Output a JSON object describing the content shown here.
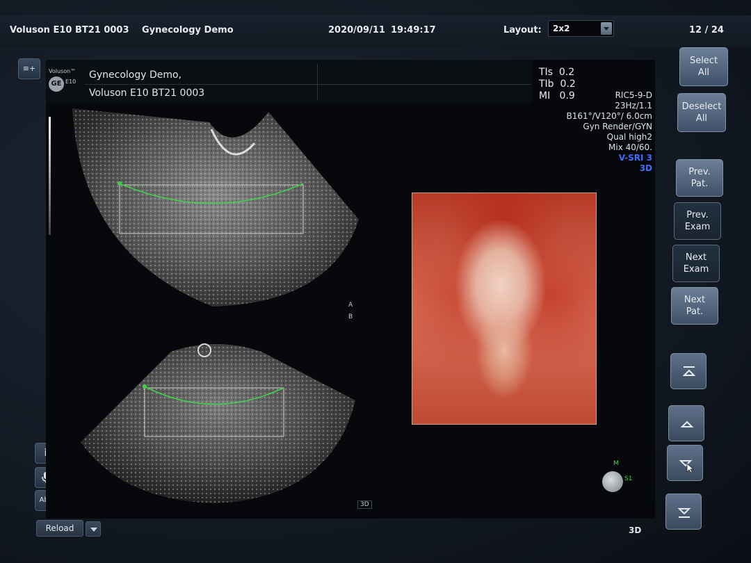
{
  "topbar": {
    "device": "Voluson E10 BT21 0003",
    "demo": "Gynecology Demo",
    "date": "2020/09/11",
    "time": "19:49:17",
    "layout_label": "Layout:",
    "layout_value": "2x2",
    "page_counter": "12 / 24"
  },
  "header": {
    "brand": "Voluson™",
    "brand_model": "E10",
    "logo": "GE",
    "line1": "Gynecology Demo,",
    "line2": "Voluson E10 BT21 0003"
  },
  "indices": {
    "tis": "TIs  0.2",
    "tib": "TIb  0.2",
    "mi": "MI   0.9"
  },
  "params": {
    "probe": "RIC5-9-D",
    "freq": "23Hz/1.1",
    "angles": "B161°/V120°/ 6.0cm",
    "render": "Gyn Render/GYN",
    "quality": "Qual high2",
    "mix": "Mix 40/60.",
    "vsri": "V-SRI 3",
    "mode": "3D"
  },
  "image_labels": {
    "plane_a": "A",
    "plane_b": "B",
    "tag_3d": "3D",
    "orient_m": "M",
    "orient_s1": "S1"
  },
  "left_tools": {
    "menu_icon": "≡+",
    "info": "i",
    "mic": "mic-icon",
    "abc": "Abc"
  },
  "reload": "Reload",
  "right_buttons": {
    "select_all": [
      "Select",
      "All"
    ],
    "deselect_all": [
      "Deselect",
      "All"
    ],
    "prev_pat": [
      "Prev.",
      "Pat."
    ],
    "prev_exam": [
      "Prev.",
      "Exam"
    ],
    "next_exam": [
      "Next",
      "Exam"
    ],
    "next_pat": [
      "Next",
      "Pat."
    ]
  },
  "footer_mode": "3D",
  "colors": {
    "accent_green": "#3fd14a",
    "blue_text": "#3f6dff",
    "button_blue": "#5a6e87"
  }
}
